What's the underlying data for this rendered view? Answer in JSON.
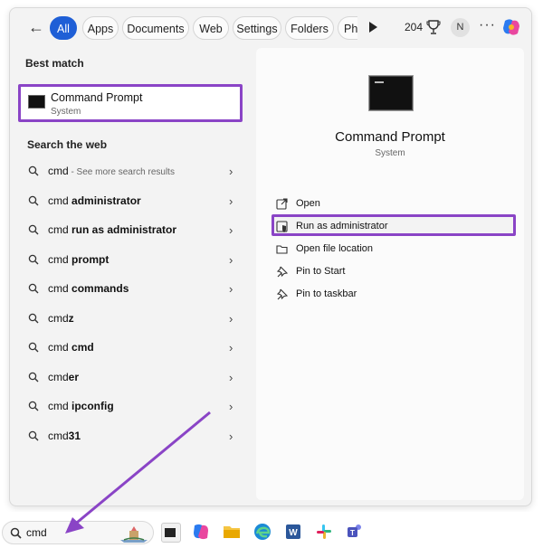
{
  "topbar": {
    "filters": [
      "All",
      "Apps",
      "Documents",
      "Web",
      "Settings",
      "Folders",
      "Ph"
    ],
    "active_filter": "All",
    "points": "204",
    "avatar_initial": "N",
    "more_label": "···"
  },
  "left": {
    "best_match_heading": "Best match",
    "best_match": {
      "title": "Command Prompt",
      "subtitle": "System"
    },
    "search_web_heading": "Search the web",
    "web_results": [
      {
        "prefix": "cmd",
        "bold": "",
        "hint": " - See more search results"
      },
      {
        "prefix": "cmd ",
        "bold": "administrator",
        "hint": ""
      },
      {
        "prefix": "cmd ",
        "bold": "run as administrator",
        "hint": ""
      },
      {
        "prefix": "cmd ",
        "bold": "prompt",
        "hint": ""
      },
      {
        "prefix": "cmd ",
        "bold": "commands",
        "hint": ""
      },
      {
        "prefix": "cmd",
        "bold": "z",
        "hint": ""
      },
      {
        "prefix": "cmd ",
        "bold": "cmd",
        "hint": ""
      },
      {
        "prefix": "cmd",
        "bold": "er",
        "hint": ""
      },
      {
        "prefix": "cmd ",
        "bold": "ipconfig",
        "hint": ""
      },
      {
        "prefix": "cmd",
        "bold": "31",
        "hint": ""
      }
    ],
    "chevron": "›"
  },
  "right": {
    "title": "Command Prompt",
    "subtitle": "System",
    "actions": [
      {
        "label": "Open",
        "icon": "open-external-icon"
      },
      {
        "label": "Run as administrator",
        "icon": "shield-admin-icon"
      },
      {
        "label": "Open file location",
        "icon": "folder-icon"
      },
      {
        "label": "Pin to Start",
        "icon": "pin-icon"
      },
      {
        "label": "Pin to taskbar",
        "icon": "pin-icon"
      }
    ]
  },
  "taskbar": {
    "search_value": "cmd",
    "apps": [
      "file-manager-icon",
      "copilot-icon",
      "folder-icon",
      "edge-icon",
      "word-icon",
      "slack-icon",
      "teams-icon"
    ]
  },
  "colors": {
    "accent": "#1f5fd6",
    "highlight": "#8a44c6"
  }
}
